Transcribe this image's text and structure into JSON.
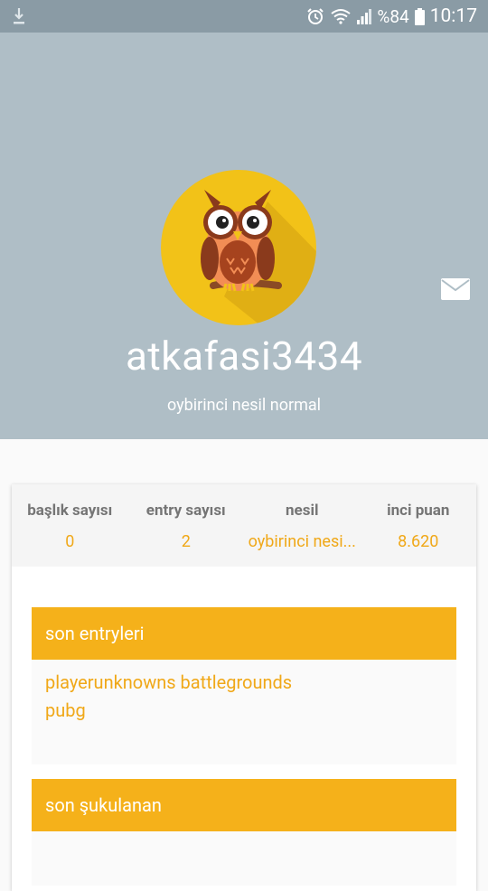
{
  "status_bar": {
    "battery_percent": "%84",
    "time": "10:17",
    "icons": [
      "download-icon",
      "alarm-icon",
      "wifi-icon",
      "signal-icon",
      "battery-icon"
    ]
  },
  "profile": {
    "username": "atkafasi3434",
    "generation_text": "oybirinci nesil normal",
    "avatar_icon": "owl-avatar",
    "message_icon": "mail-icon"
  },
  "stats": [
    {
      "label": "başlık sayısı",
      "value": "0"
    },
    {
      "label": "entry sayısı",
      "value": "2"
    },
    {
      "label": "nesil",
      "value": "oybirinci nesi..."
    },
    {
      "label": "inci puan",
      "value": "8.620"
    }
  ],
  "sections": {
    "recent_entries": {
      "title": "son entryleri",
      "items": [
        "playerunknowns battlegrounds",
        "pubg"
      ]
    },
    "recent_liked": {
      "title": "son şukulanan",
      "items": []
    }
  },
  "colors": {
    "header_bg": "#afbec6",
    "accent": "#f5b11a",
    "avatar_bg": "#f2c218"
  }
}
